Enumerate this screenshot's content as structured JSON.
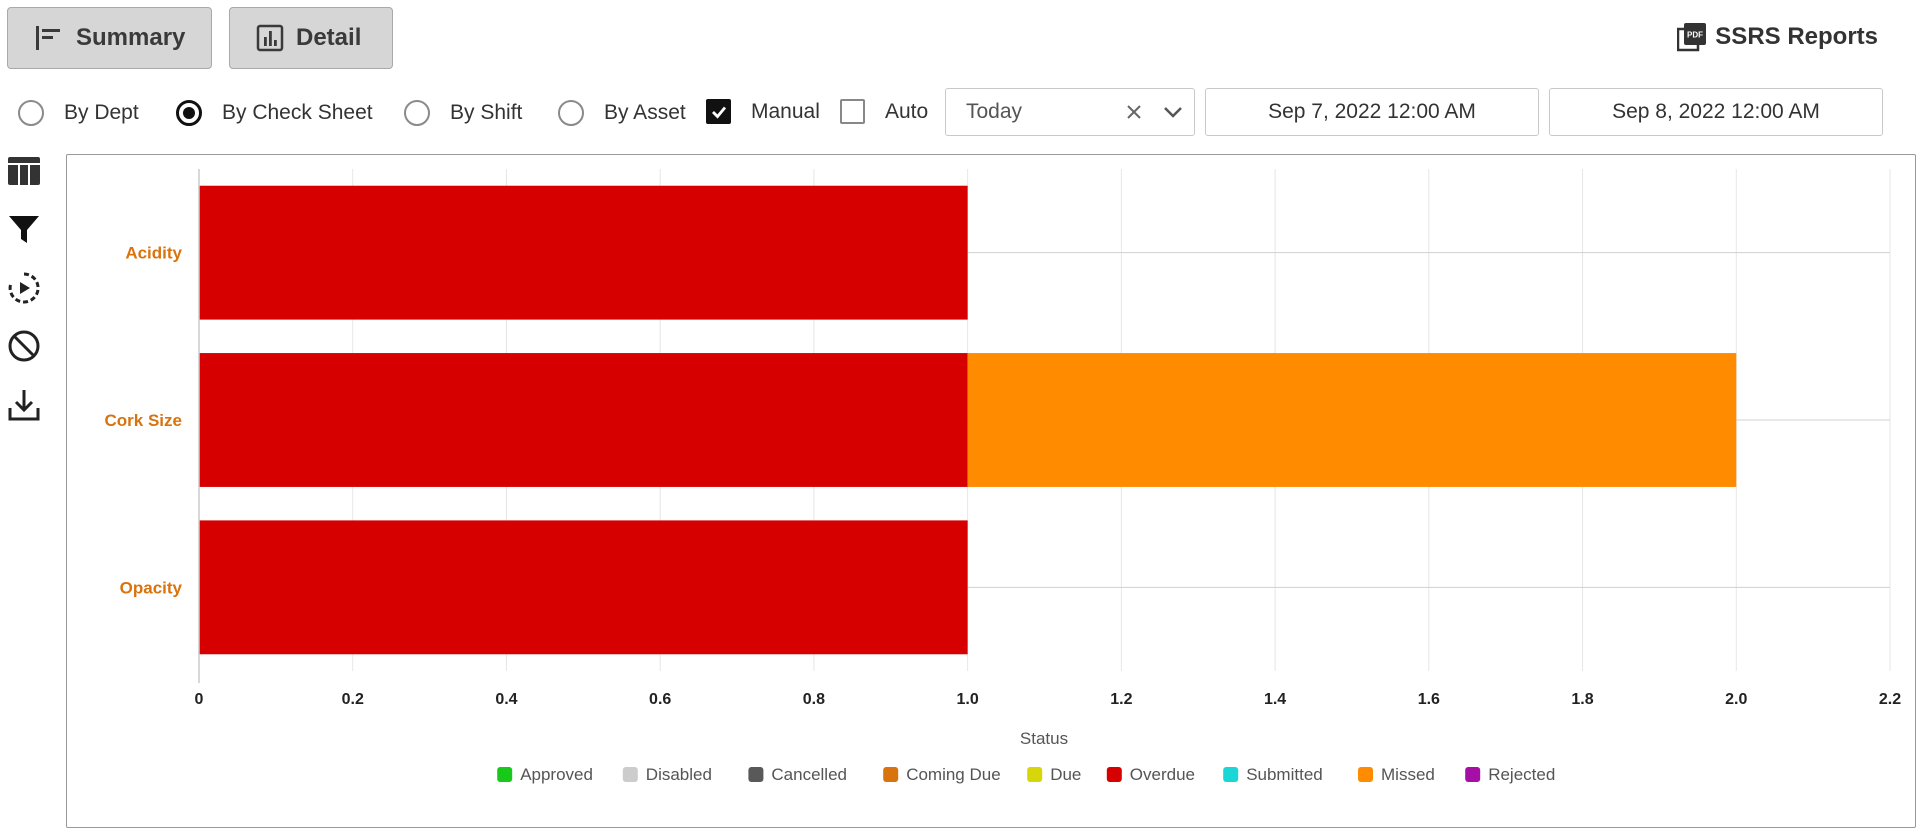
{
  "toolbar": {
    "summary_label": "Summary",
    "detail_label": "Detail",
    "ssrs_label": "SSRS Reports"
  },
  "filters": {
    "group_by": [
      {
        "label": "By Dept",
        "selected": false
      },
      {
        "label": "By Check Sheet",
        "selected": true
      },
      {
        "label": "By Shift",
        "selected": false
      },
      {
        "label": "By Asset",
        "selected": false
      }
    ],
    "manual": {
      "label": "Manual",
      "checked": true
    },
    "auto": {
      "label": "Auto",
      "checked": false
    },
    "range": {
      "value": "Today"
    },
    "date_from": "Sep 7, 2022 12:00 AM",
    "date_to": "Sep 8, 2022 12:00 AM"
  },
  "sidebar_icons": [
    "table-icon",
    "filter-icon",
    "play-refresh-icon",
    "block-icon",
    "download-icon"
  ],
  "chart_data": {
    "type": "bar",
    "orientation": "horizontal",
    "stacked": true,
    "categories": [
      "Acidity",
      "Cork Size",
      "Opacity"
    ],
    "xlabel": "Status",
    "ylabel": "",
    "xlim": [
      0,
      2.2
    ],
    "xticks": [
      "0",
      "0.2",
      "0.4",
      "0.6",
      "0.8",
      "1.0",
      "1.2",
      "1.4",
      "1.6",
      "1.8",
      "2.0",
      "2.2"
    ],
    "grid": true,
    "legend_position": "bottom",
    "series": [
      {
        "name": "Approved",
        "color": "#19c919",
        "values": [
          0,
          0,
          0
        ]
      },
      {
        "name": "Disabled",
        "color": "#cccccc",
        "values": [
          0,
          0,
          0
        ]
      },
      {
        "name": "Cancelled",
        "color": "#595959",
        "values": [
          0,
          0,
          0
        ]
      },
      {
        "name": "Coming Due",
        "color": "#d9730d",
        "values": [
          0,
          0,
          0
        ]
      },
      {
        "name": "Due",
        "color": "#d6d60a",
        "values": [
          0,
          0,
          0
        ]
      },
      {
        "name": "Overdue",
        "color": "#d60000",
        "values": [
          1,
          1,
          1
        ]
      },
      {
        "name": "Submitted",
        "color": "#1ad6d6",
        "values": [
          0,
          0,
          0
        ]
      },
      {
        "name": "Missed",
        "color": "#ff8c00",
        "values": [
          0,
          1,
          0
        ]
      },
      {
        "name": "Rejected",
        "color": "#a60fa6",
        "values": [
          0,
          0,
          0
        ]
      }
    ]
  }
}
